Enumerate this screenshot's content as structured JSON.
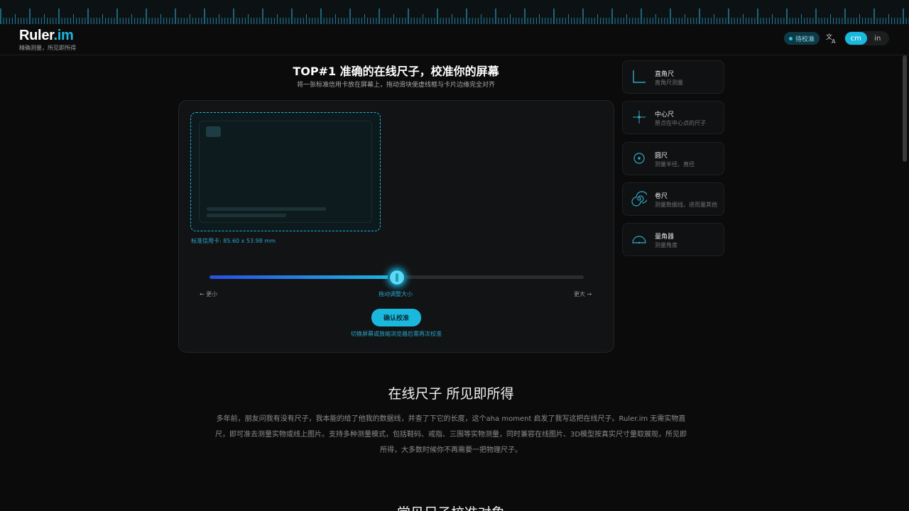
{
  "header": {
    "logo_main": "Ruler",
    "logo_accent": ".im",
    "logo_subtitle": "精确测量，所见即所得",
    "status_label": "待校准",
    "translate_icon": "translate-icon",
    "units": [
      "cm",
      "in"
    ],
    "active_unit": "cm"
  },
  "hero": {
    "title": "TOP#1 准确的在线尺子，校准你的屏幕",
    "subtitle": "将一张标准信用卡放在屏幕上，拖动滑块使虚线框与卡片边缘完全对齐"
  },
  "calibration": {
    "card_caption": "标准信用卡: 85.60 x 53.98 mm",
    "slider_fraction": 0.5,
    "label_smaller": "← 更小",
    "label_drag": "拖动调整大小",
    "label_larger": "更大 →",
    "confirm_label": "确认校准",
    "note": "切换屏幕或放缩浏览器后需再次校准"
  },
  "tools": [
    {
      "name": "直角尺",
      "desc": "直角尺测量",
      "icon": "right-angle-ruler-icon"
    },
    {
      "name": "中心尺",
      "desc": "原点在中心点的尺子",
      "icon": "center-ruler-icon"
    },
    {
      "name": "圆尺",
      "desc": "测量半径、直径",
      "icon": "circle-ruler-icon"
    },
    {
      "name": "卷尺",
      "desc": "测量数据线，进而量其他",
      "icon": "tape-measure-icon"
    },
    {
      "name": "量角器",
      "desc": "测量角度",
      "icon": "protractor-icon"
    }
  ],
  "intro": {
    "title": "在线尺子 所见即所得",
    "body": "多年前，朋友问我有没有尺子，我本能的给了他我的数据线，并查了下它的长度，这个aha moment 启发了我写这把在线尺子。Ruler.im 无需实物直尺，即可准去测量实物或线上图片。支持多种测量模式，包括鞋码、戒指、三围等实物测量，同时兼容在线图片、3D模型按真实尺寸量取展现，所见即所得，大多数时候你不再需要一把物理尺子。"
  },
  "next_section": {
    "title": "常见尺子校准对象"
  },
  "colors": {
    "accent": "#1bb8de",
    "background": "#0b0b0b",
    "panel": "#121315"
  }
}
